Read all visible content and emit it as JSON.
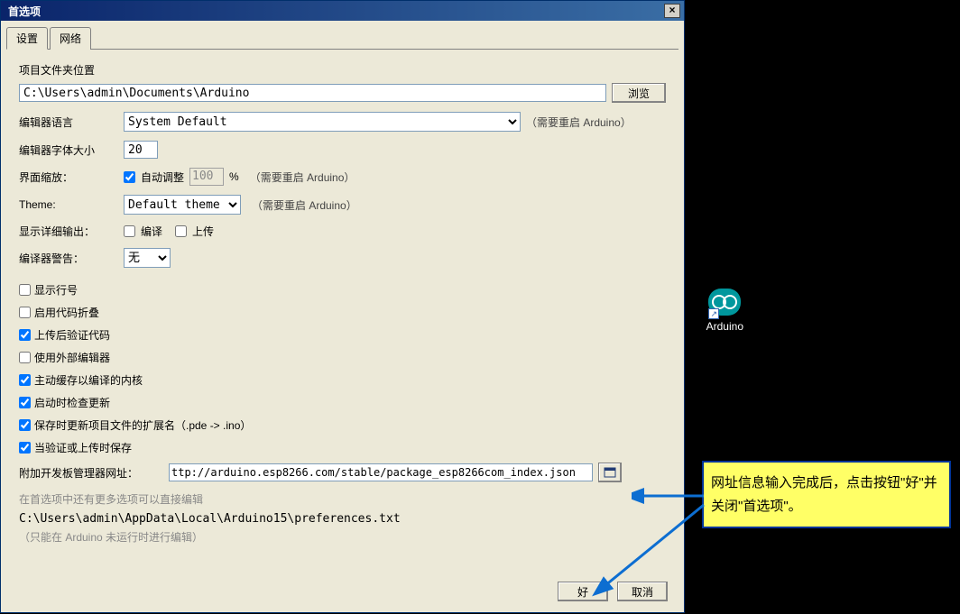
{
  "window": {
    "title": "首选项"
  },
  "tabs": {
    "settings": "设置",
    "network": "网络"
  },
  "sketchbook": {
    "label": "项目文件夹位置",
    "path": "C:\\Users\\admin\\Documents\\Arduino",
    "browse": "浏览"
  },
  "editor": {
    "lang_label": "编辑器语言",
    "lang_value": "System Default",
    "lang_note": "（需要重启 Arduino）",
    "fontsize_label": "编辑器字体大小",
    "fontsize": "20",
    "scale_label": "界面缩放：",
    "scale_auto": "自动调整",
    "scale_value": "100",
    "scale_pct": "%",
    "scale_note": "（需要重启 Arduino）",
    "theme_label": "Theme:",
    "theme_value": "Default theme",
    "theme_note": "（需要重启 Arduino）",
    "verbose_label": "显示详细输出：",
    "verbose_compile": "编译",
    "verbose_upload": "上传",
    "warn_label": "编译器警告：",
    "warn_value": "无"
  },
  "checks": {
    "line_numbers": "显示行号",
    "code_folding": "启用代码折叠",
    "verify_after_upload": "上传后验证代码",
    "external_editor": "使用外部编辑器",
    "cache_core": "主动缓存以编译的内核",
    "check_updates": "启动时检查更新",
    "save_ext": "保存时更新项目文件的扩展名（.pde -> .ino）",
    "save_on_verify": "当验证或上传时保存"
  },
  "boards": {
    "label": "附加开发板管理器网址：",
    "url": "ttp://arduino.esp8266.com/stable/package_esp8266com_index.json"
  },
  "footer": {
    "more_prefs": "在首选项中还有更多选项可以直接编辑",
    "path": "C:\\Users\\admin\\AppData\\Local\\Arduino15\\preferences.txt",
    "edit_note": "（只能在 Arduino 未运行时进行编辑）"
  },
  "buttons": {
    "ok": "好",
    "cancel": "取消"
  },
  "desktop": {
    "arduino": "Arduino"
  },
  "callout": {
    "text": "网址信息输入完成后，点击按钮\"好\"并关闭\"首选项\"。"
  }
}
